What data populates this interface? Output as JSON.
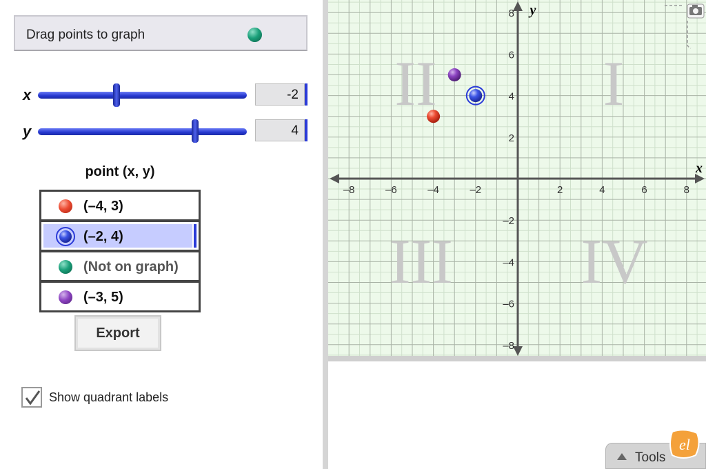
{
  "drag_box": {
    "label": "Drag points to graph"
  },
  "sliders": {
    "x": {
      "label": "x",
      "value": "-2",
      "range": [
        -8,
        8
      ]
    },
    "y": {
      "label": "y",
      "value": "4",
      "range": [
        -8,
        8
      ]
    }
  },
  "table": {
    "title": "point (x, y)",
    "rows": [
      {
        "color": "red",
        "text": "(–4, 3)",
        "selected": false
      },
      {
        "color": "blue",
        "text": "(–2, 4)",
        "selected": true
      },
      {
        "color": "green",
        "text": "(Not on graph)",
        "selected": false
      },
      {
        "color": "purple",
        "text": "(–3, 5)",
        "selected": false
      }
    ]
  },
  "export_label": "Export",
  "show_quadrant": {
    "label": "Show quadrant labels",
    "checked": true
  },
  "graph": {
    "x_axis_label": "x",
    "y_axis_label": "y",
    "x_ticks": [
      "–8",
      "–6",
      "–4",
      "–2",
      "2",
      "4",
      "6",
      "8"
    ],
    "y_ticks": [
      "8",
      "6",
      "4",
      "2",
      "–2",
      "–4",
      "–6",
      "–8"
    ],
    "quadrant_labels": [
      "I",
      "II",
      "III",
      "IV"
    ],
    "points": [
      {
        "color": "red",
        "x": -4,
        "y": 3
      },
      {
        "color": "purple",
        "x": -3,
        "y": 5
      },
      {
        "color": "blue",
        "x": -2,
        "y": 4,
        "selected": true
      }
    ]
  },
  "tools_label": "Tools",
  "logo_text": "el",
  "colors": {
    "accent": "#2b3bd8",
    "grid_bg": "#edf9ea",
    "grid_line": "#a9b3a6"
  }
}
